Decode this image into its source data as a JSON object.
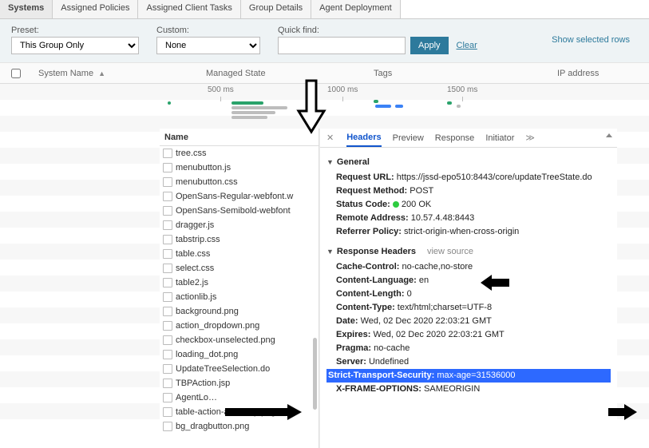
{
  "tabs": {
    "items": [
      {
        "label": "Systems",
        "active": true
      },
      {
        "label": "Assigned Policies"
      },
      {
        "label": "Assigned Client Tasks"
      },
      {
        "label": "Group Details"
      },
      {
        "label": "Agent Deployment"
      }
    ]
  },
  "filter": {
    "preset_label": "Preset:",
    "preset_value": "This Group Only",
    "custom_label": "Custom:",
    "custom_value": "None",
    "quickfind_label": "Quick find:",
    "quickfind_value": "",
    "apply": "Apply",
    "clear": "Clear",
    "show_selected": "Show selected rows"
  },
  "columns": {
    "system_name": "System Name",
    "managed_state": "Managed State",
    "tags": "Tags",
    "ip": "IP address"
  },
  "timeline": {
    "ticks": [
      "500 ms",
      "1000 ms",
      "1500 ms"
    ]
  },
  "filelist": {
    "header": "Name",
    "items": [
      "tree.css",
      "menubutton.js",
      "menubutton.css",
      "OpenSans-Regular-webfont.w",
      "OpenSans-Semibold-webfont",
      "dragger.js",
      "tabstrip.css",
      "table.css",
      "select.css",
      "table2.js",
      "actionlib.js",
      "background.png",
      "action_dropdown.png",
      "checkbox-unselected.png",
      "loading_dot.png",
      "UpdateTreeSelection.do",
      "TBPAction.jsp",
      "AgentLo…",
      "table-action-arrow-up.png",
      "bg_dragbutton.png"
    ]
  },
  "nettabs": {
    "items": [
      "Headers",
      "Preview",
      "Response",
      "Initiator"
    ],
    "active": 0
  },
  "general": {
    "title": "General",
    "request_url_k": "Request URL:",
    "request_url_v": "https://jssd-epo510:8443/core/updateTreeState.do",
    "method_k": "Request Method:",
    "method_v": "POST",
    "status_k": "Status Code:",
    "status_v": "200 OK",
    "remote_k": "Remote Address:",
    "remote_v": "10.57.4.48:8443",
    "refpol_k": "Referrer Policy:",
    "refpol_v": "strict-origin-when-cross-origin"
  },
  "resp": {
    "title": "Response Headers",
    "view_source": "view source",
    "rows": [
      {
        "k": "Cache-Control:",
        "v": "no-cache,no-store"
      },
      {
        "k": "Content-Language:",
        "v": "en"
      },
      {
        "k": "Content-Length:",
        "v": "0"
      },
      {
        "k": "Content-Type:",
        "v": "text/html;charset=UTF-8"
      },
      {
        "k": "Date:",
        "v": "Wed, 02 Dec 2020 22:03:21 GMT"
      },
      {
        "k": "Expires:",
        "v": "Wed, 02 Dec 2020 22:03:21 GMT"
      },
      {
        "k": "Pragma:",
        "v": "no-cache"
      },
      {
        "k": "Server:",
        "v": "Undefined"
      },
      {
        "k": "Strict-Transport-Security:",
        "v": "max-age=31536000",
        "hl": true
      },
      {
        "k": "X-FRAME-OPTIONS:",
        "v": "SAMEORIGIN"
      }
    ]
  }
}
